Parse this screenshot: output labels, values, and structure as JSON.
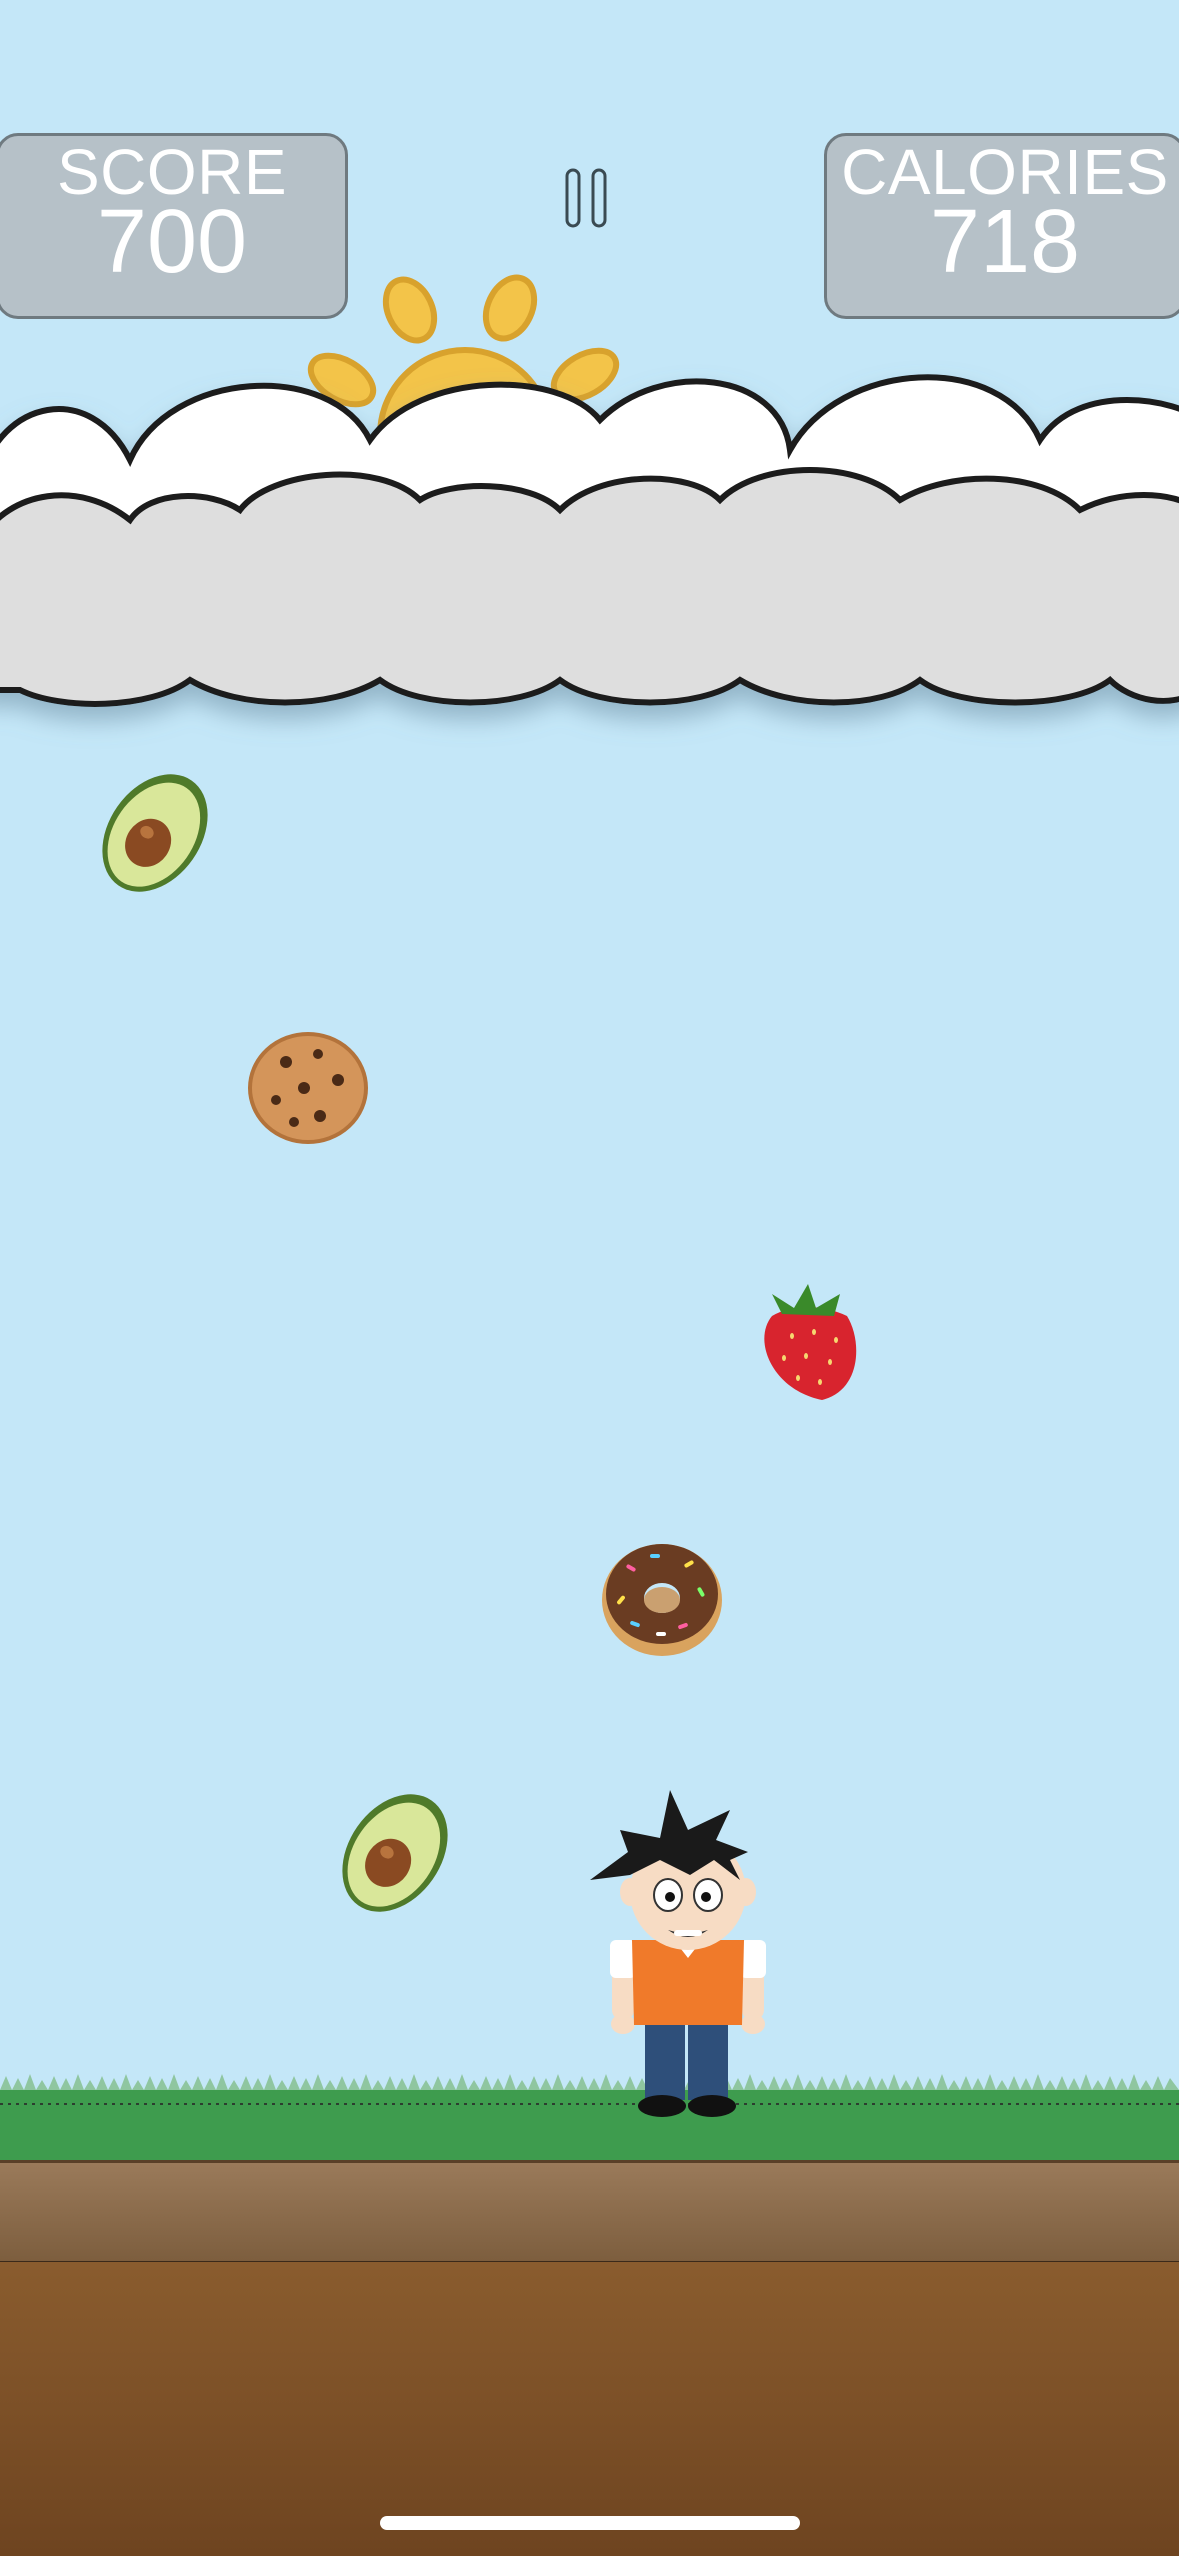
{
  "hud": {
    "score_label": "SCORE",
    "score_value": "700",
    "calories_label": "CALORIES",
    "calories_value": "718"
  },
  "colors": {
    "sky": "#c4e7f8",
    "hud_panel": "#b6c1c8",
    "grass": "#3e9c4e",
    "dirt": "#7d5e3e",
    "player_shirt": "#f07a2a",
    "player_pants": "#2e4f7a"
  },
  "falling_items": [
    {
      "name": "avocado"
    },
    {
      "name": "cookie"
    },
    {
      "name": "strawberry"
    },
    {
      "name": "donut"
    },
    {
      "name": "avocado"
    }
  ]
}
